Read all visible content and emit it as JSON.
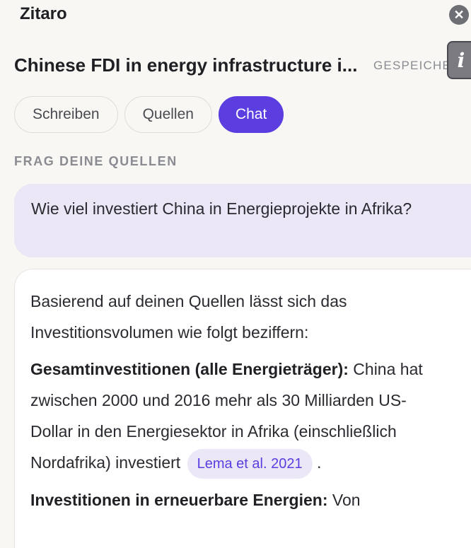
{
  "app": {
    "name": "Zitaro"
  },
  "header": {
    "doc_title": "Chinese FDI in energy infrastructure i...",
    "saved_status": "GESPEICHERT",
    "close_glyph": "✕",
    "info_glyph": "i"
  },
  "tabs": [
    {
      "label": "Schreiben",
      "active": false
    },
    {
      "label": "Quellen",
      "active": false
    },
    {
      "label": "Chat",
      "active": true
    }
  ],
  "chat": {
    "section_label": "FRAG DEINE QUELLEN",
    "user_question": "Wie viel investiert China in Energieprojekte in Afrika?",
    "answer": {
      "intro": "Basierend auf deinen Quellen lässt sich das Investitionsvolumen wie folgt beziffern:",
      "point1_heading": "Gesamtinvestitionen (alle Energieträger):",
      "point1_text": " China hat zwischen 2000 und 2016 mehr als 30 Milliarden US-Dollar in den Energiesektor in Afrika (einschließlich Nordafrika) investiert",
      "point1_citation": "Lema et al. 2021",
      "point1_end": " .",
      "point2_heading": "Investitionen in erneuerbare Energien:",
      "point2_text": " Von"
    }
  },
  "colors": {
    "accent": "#5b3de0",
    "user_bubble": "#ebe7f7",
    "background": "#f8f7f4"
  },
  "icons": {
    "close": "close-icon",
    "info": "info-icon"
  }
}
